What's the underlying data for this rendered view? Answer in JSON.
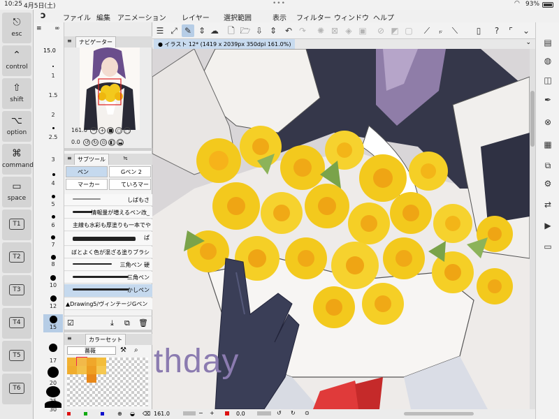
{
  "status": {
    "time": "10:25",
    "date": "4月5日(土)",
    "battery": "93%"
  },
  "menu": [
    "ファイル",
    "編集",
    "アニメーション",
    "レイヤー",
    "選択範囲",
    "表示",
    "フィルター",
    "ウィンドウ",
    "ヘルプ"
  ],
  "modifiers": [
    {
      "glyph": "⎋",
      "label": "esc",
      "name": "esc-key"
    },
    {
      "glyph": "⌃",
      "label": "control",
      "name": "control-key"
    },
    {
      "glyph": "⇧",
      "label": "shift",
      "name": "shift-key"
    },
    {
      "glyph": "⌥",
      "label": "option",
      "name": "option-key"
    },
    {
      "glyph": "⌘",
      "label": "command",
      "name": "command-key"
    },
    {
      "glyph": "▭",
      "label": "space",
      "name": "space-key"
    }
  ],
  "tbuttons": [
    "T1",
    "T2",
    "T3",
    "T4",
    "T5",
    "T6"
  ],
  "ruler": {
    "zoom": "15.0",
    "ticks": [
      "1",
      "1.5",
      "2",
      "2.5",
      "3",
      "4",
      "5",
      "6",
      "7",
      "8",
      "10",
      "12",
      "15",
      "17",
      "20",
      "25",
      "30"
    ]
  },
  "navigator": {
    "tab": "ナビゲーター",
    "zoom": "161.0",
    "angle": "0.0"
  },
  "subtool": {
    "tab": "サブツール",
    "chips": [
      "ペン",
      "Gペン 2",
      "マーカー",
      "ていろマー"
    ],
    "brushes": [
      "しばもさ",
      "情報量が増えるペン改_",
      "主線も水彩も厚塗りも一本でや",
      "ぱ",
      "ぼとよく色が混ざる塗りブラシ",
      "三角ペン 硬",
      "三角ペン",
      "かしペン",
      "▲Drawing5/ヴィンテージGペン"
    ]
  },
  "colorset": {
    "tab": "カラーセット",
    "selected": "薔薇"
  },
  "canvas": {
    "title": "● イラスト 12* (1419 x 2039px 350dpi 161.0%)",
    "overlay_text": "thday"
  },
  "bottom": {
    "zoom": "161.0",
    "angle": "0.0"
  },
  "colors": {
    "accent": "#b6cde6",
    "rose": "#f3c91d",
    "glove": "#3a3e57"
  }
}
